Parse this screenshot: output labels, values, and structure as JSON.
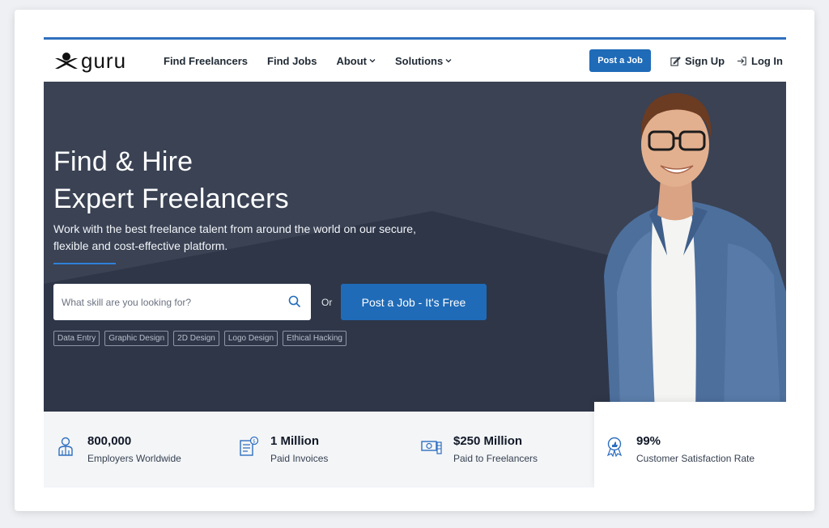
{
  "header": {
    "logo_text": "guru",
    "nav": [
      {
        "label": "Find Freelancers"
      },
      {
        "label": "Find Jobs"
      },
      {
        "label": "About"
      },
      {
        "label": "Solutions"
      }
    ],
    "post_job_label": "Post a Job",
    "sign_up_label": "Sign Up",
    "log_in_label": "Log In"
  },
  "hero": {
    "title_line1": "Find & Hire",
    "title_line2": "Expert Freelancers",
    "subtitle": "Work with the best freelance talent from around the world on our secure, flexible and cost-effective platform.",
    "search_placeholder": "What skill are you looking for?",
    "or_text": "Or",
    "cta_label": "Post a Job - It's Free",
    "tags": [
      "Data Entry",
      "Graphic Design",
      "2D Design",
      "Logo Design",
      "Ethical Hacking"
    ]
  },
  "stats": [
    {
      "value": "800,000",
      "label": "Employers Worldwide",
      "icon": "employer-icon"
    },
    {
      "value": "1 Million",
      "label": "Paid Invoices",
      "icon": "invoice-icon"
    },
    {
      "value": "$250 Million",
      "label": "Paid to Freelancers",
      "icon": "money-icon"
    },
    {
      "value": "99%",
      "label": "Customer Satisfaction Rate",
      "icon": "award-icon"
    }
  ],
  "colors": {
    "brand_blue": "#1f6bb8",
    "hero_bg": "#2e3648",
    "top_border": "#2f6fbf"
  }
}
